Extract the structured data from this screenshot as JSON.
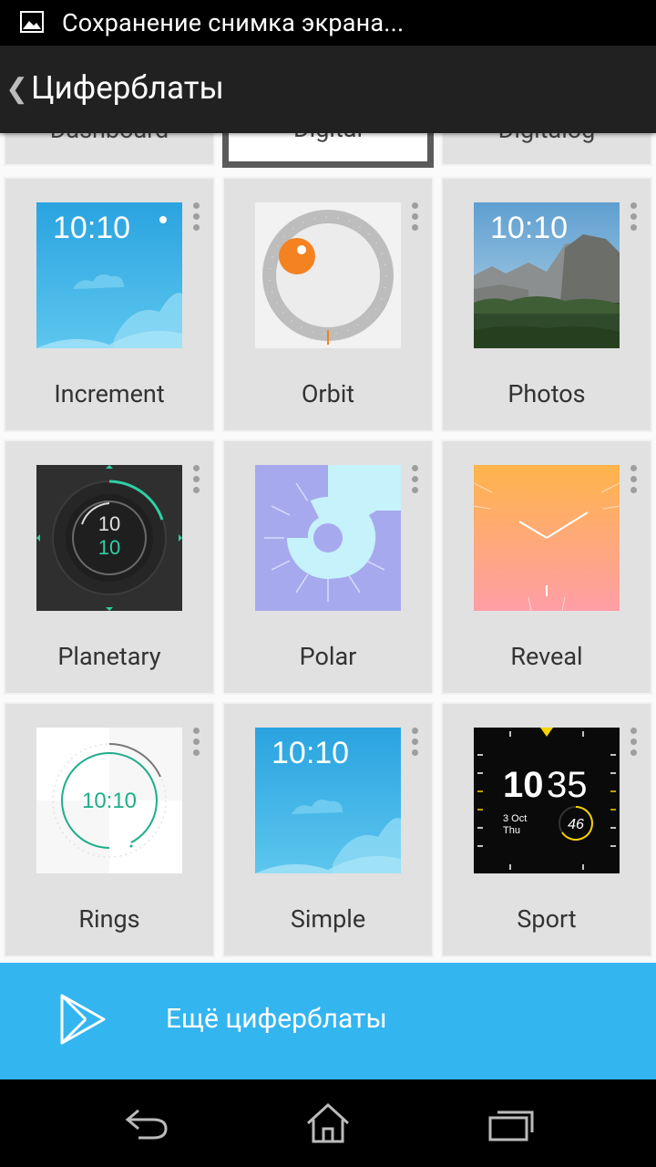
{
  "status_bar": {
    "notification_text": "Сохранение снимка экрана...",
    "icon": "image-icon"
  },
  "action_bar": {
    "back_icon": "back-chevron-icon",
    "title": "Циферблаты"
  },
  "top_partial": [
    {
      "label": "Dashboard",
      "selected": false
    },
    {
      "label": "Digital",
      "selected": true
    },
    {
      "label": "Digitalog",
      "selected": false
    }
  ],
  "watch_faces": [
    {
      "label": "Increment",
      "time": "10:10"
    },
    {
      "label": "Orbit"
    },
    {
      "label": "Photos",
      "time": "10:10"
    },
    {
      "label": "Planetary",
      "hour": "10",
      "minute": "10"
    },
    {
      "label": "Polar"
    },
    {
      "label": "Reveal"
    },
    {
      "label": "Rings",
      "time": "10:10"
    },
    {
      "label": "Simple",
      "time": "10:10"
    },
    {
      "label": "Sport",
      "hour": "10",
      "minute": "35",
      "date": "3 Oct",
      "day": "Thu",
      "seconds": "46"
    }
  ],
  "more_button": {
    "label": "Ещё циферблаты",
    "icon": "play-store-icon"
  },
  "nav_bar": {
    "back": "nav-back-icon",
    "home": "nav-home-icon",
    "recents": "nav-recents-icon"
  },
  "colors": {
    "accent": "#33b5f0",
    "card_bg": "#e1e1e1",
    "action_bar": "#212121"
  }
}
